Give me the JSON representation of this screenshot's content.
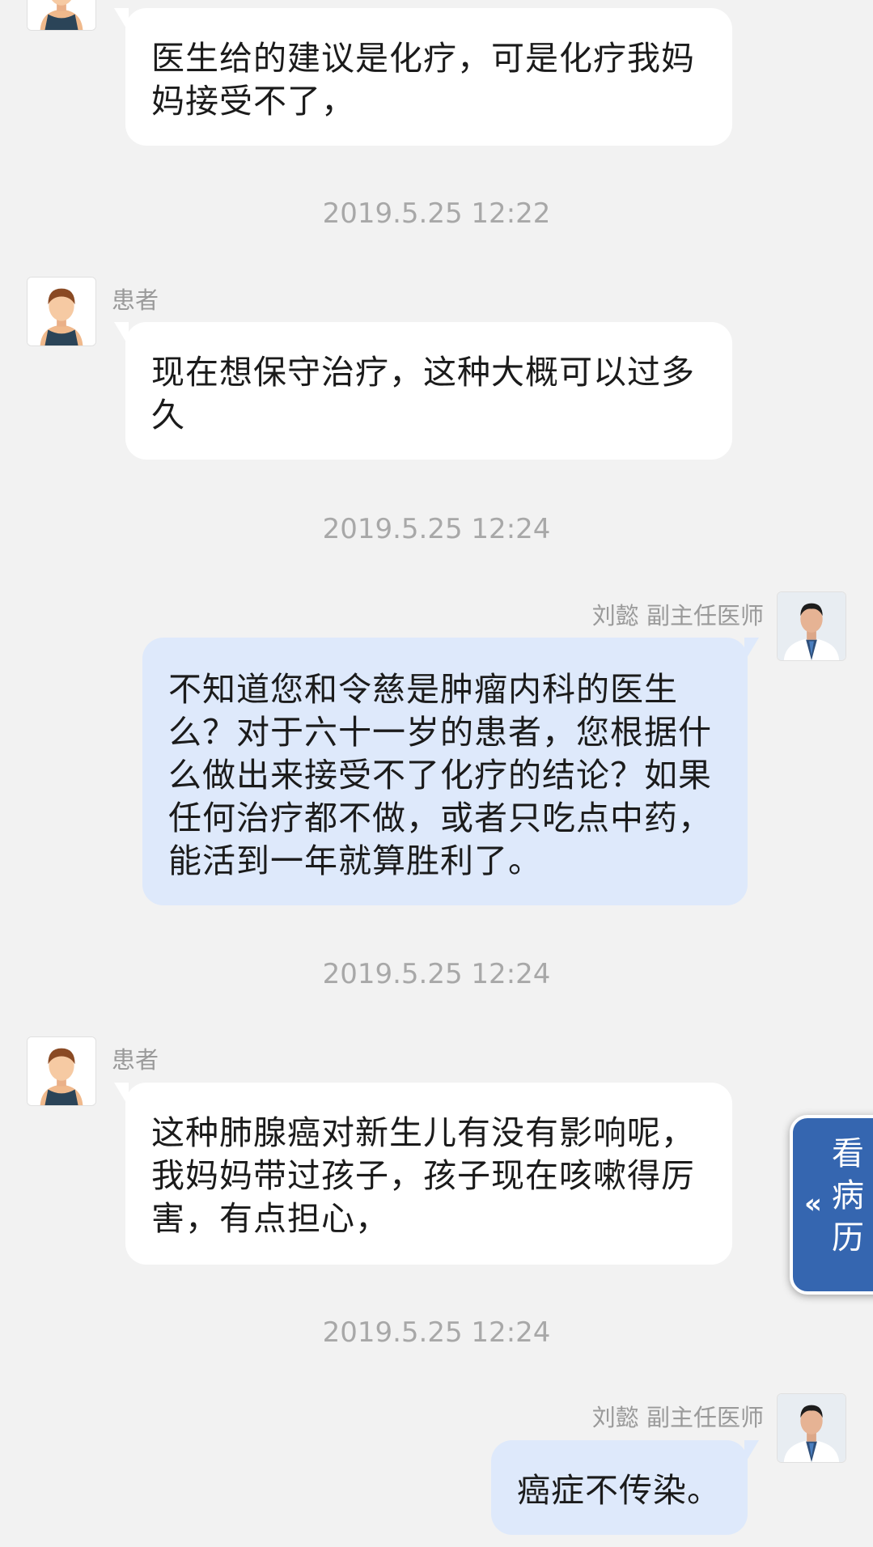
{
  "labels": {
    "patient": "患者",
    "doctor": "刘懿 副主任医师"
  },
  "messages": [
    {
      "from": "patient",
      "text": "医生给的建议是化疗，可是化疗我妈妈接受不了，"
    },
    {
      "from": "patient",
      "time": "2019.5.25 12:22",
      "text": "现在想保守治疗，这种大概可以过多久"
    },
    {
      "from": "doctor",
      "time": "2019.5.25 12:24",
      "text": "不知道您和令慈是肿瘤内科的医生么？对于六十一岁的患者，您根据什么做出来接受不了化疗的结论？如果任何治疗都不做，或者只吃点中药，能活到一年就算胜利了。"
    },
    {
      "from": "patient",
      "time": "2019.5.25 12:24",
      "text": "这种肺腺癌对新生儿有没有影响呢，我妈妈带过孩子，孩子现在咳嗽得厉害，有点担心，"
    },
    {
      "from": "doctor",
      "time": "2019.5.25 12:24",
      "text": "癌症不传染。"
    }
  ],
  "side_tab": {
    "chars": [
      "看",
      "病",
      "历"
    ],
    "icon": "double-chevron-left-icon"
  },
  "colors": {
    "background": "#f2f2f2",
    "incoming_bubble": "#ffffff",
    "outgoing_bubble": "#dee9fb",
    "tab": "#3566b0"
  }
}
